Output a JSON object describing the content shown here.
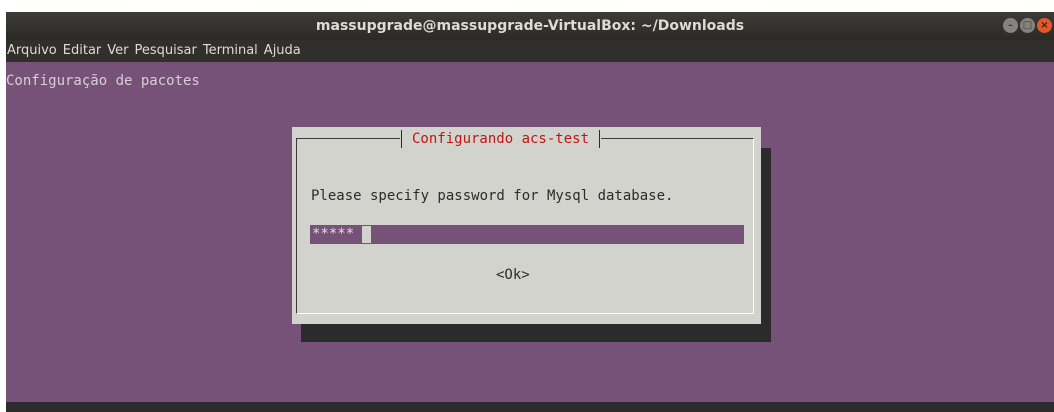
{
  "window": {
    "title": "massupgrade@massupgrade-VirtualBox: ~/Downloads",
    "controls": {
      "minimize": "–",
      "maximize": "□",
      "close": "×"
    }
  },
  "menubar": {
    "items": [
      "Arquivo",
      "Editar",
      "Ver",
      "Pesquisar",
      "Terminal",
      "Ajuda"
    ]
  },
  "terminal": {
    "heading": "Configuração de pacotes",
    "background": "#775278"
  },
  "dialog": {
    "title": "Configurando acs-test",
    "prompt": "Please specify password for Mysql database.",
    "password_value": "*****",
    "ok_label": "<Ok>"
  }
}
